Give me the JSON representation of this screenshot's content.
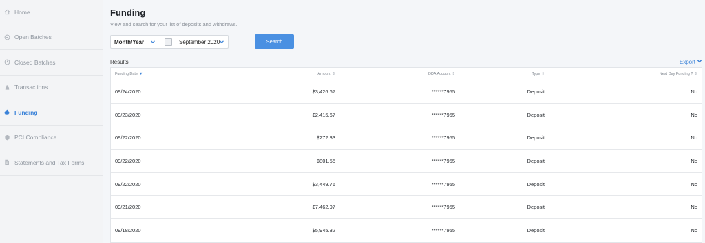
{
  "sidebar": {
    "items": [
      {
        "label": "Home",
        "icon": "home-icon"
      },
      {
        "label": "Open Batches",
        "icon": "open-batches-icon"
      },
      {
        "label": "Closed Batches",
        "icon": "clock-icon"
      },
      {
        "label": "Transactions",
        "icon": "money-bag-icon"
      },
      {
        "label": "Funding",
        "icon": "piggy-bank-icon"
      },
      {
        "label": "PCI Compliance",
        "icon": "shield-icon"
      },
      {
        "label": "Statements and Tax Forms",
        "icon": "document-icon"
      }
    ],
    "active_item": "Funding"
  },
  "page": {
    "title": "Funding",
    "subtitle": "View and search for your list of deposits and withdraws."
  },
  "filters": {
    "period_type": "Month/Year",
    "period_value": "September 2020",
    "search_label": "Search"
  },
  "results": {
    "label": "Results",
    "export_label": "Export",
    "columns": [
      "Funding Date",
      "Amount",
      "DDA Account",
      "Type",
      "Next Day Funding ?"
    ],
    "rows": [
      {
        "date": "09/24/2020",
        "amount": "$3,426.67",
        "account": "******7955",
        "type": "Deposit",
        "next_day": "No"
      },
      {
        "date": "09/23/2020",
        "amount": "$2,415.67",
        "account": "******7955",
        "type": "Deposit",
        "next_day": "No"
      },
      {
        "date": "09/22/2020",
        "amount": "$272.33",
        "account": "******7955",
        "type": "Deposit",
        "next_day": "No"
      },
      {
        "date": "09/22/2020",
        "amount": "$801.55",
        "account": "******7955",
        "type": "Deposit",
        "next_day": "No"
      },
      {
        "date": "09/22/2020",
        "amount": "$3,449.76",
        "account": "******7955",
        "type": "Deposit",
        "next_day": "No"
      },
      {
        "date": "09/21/2020",
        "amount": "$7,462.97",
        "account": "******7955",
        "type": "Deposit",
        "next_day": "No"
      },
      {
        "date": "09/18/2020",
        "amount": "$5,945.32",
        "account": "******7955",
        "type": "Deposit",
        "next_day": "No"
      }
    ]
  },
  "colors": {
    "accent": "#4a90e2",
    "link": "#3a82d8",
    "sidebar_bg": "#f3f4f6",
    "muted_text": "#9097a0"
  }
}
